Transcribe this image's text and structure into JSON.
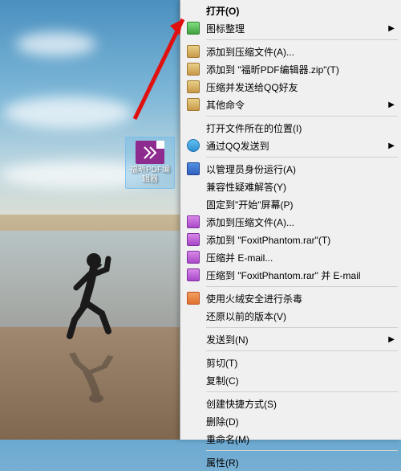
{
  "desktop_icon": {
    "label": "福昕PDF编辑器"
  },
  "menu": {
    "open": "打开(O)",
    "icon_arrange": "图标整理",
    "add_to_archive": "添加到压缩文件(A)...",
    "add_to_named_zip": "添加到 \"福昕PDF编辑器.zip\"(T)",
    "compress_send_qq": "压缩并发送给QQ好友",
    "other_cmd": "其他命令",
    "open_file_location": "打开文件所在的位置(I)",
    "send_via_qq": "通过QQ发送到",
    "run_as_admin": "以管理员身份运行(A)",
    "compat_troubleshoot": "兼容性疑难解答(Y)",
    "pin_to_start": "固定到\"开始\"屏幕(P)",
    "add_to_archive2": "添加到压缩文件(A)...",
    "add_to_foxit_rar": "添加到 \"FoxitPhantom.rar\"(T)",
    "compress_email": "压缩并 E-mail...",
    "compress_foxit_email": "压缩到 \"FoxitPhantom.rar\" 并 E-mail",
    "huorong_scan": "使用火绒安全进行杀毒",
    "restore_prev": "还原以前的版本(V)",
    "send_to": "发送到(N)",
    "cut": "剪切(T)",
    "copy": "复制(C)",
    "create_shortcut": "创建快捷方式(S)",
    "delete": "删除(D)",
    "rename": "重命名(M)",
    "properties": "属性(R)"
  }
}
